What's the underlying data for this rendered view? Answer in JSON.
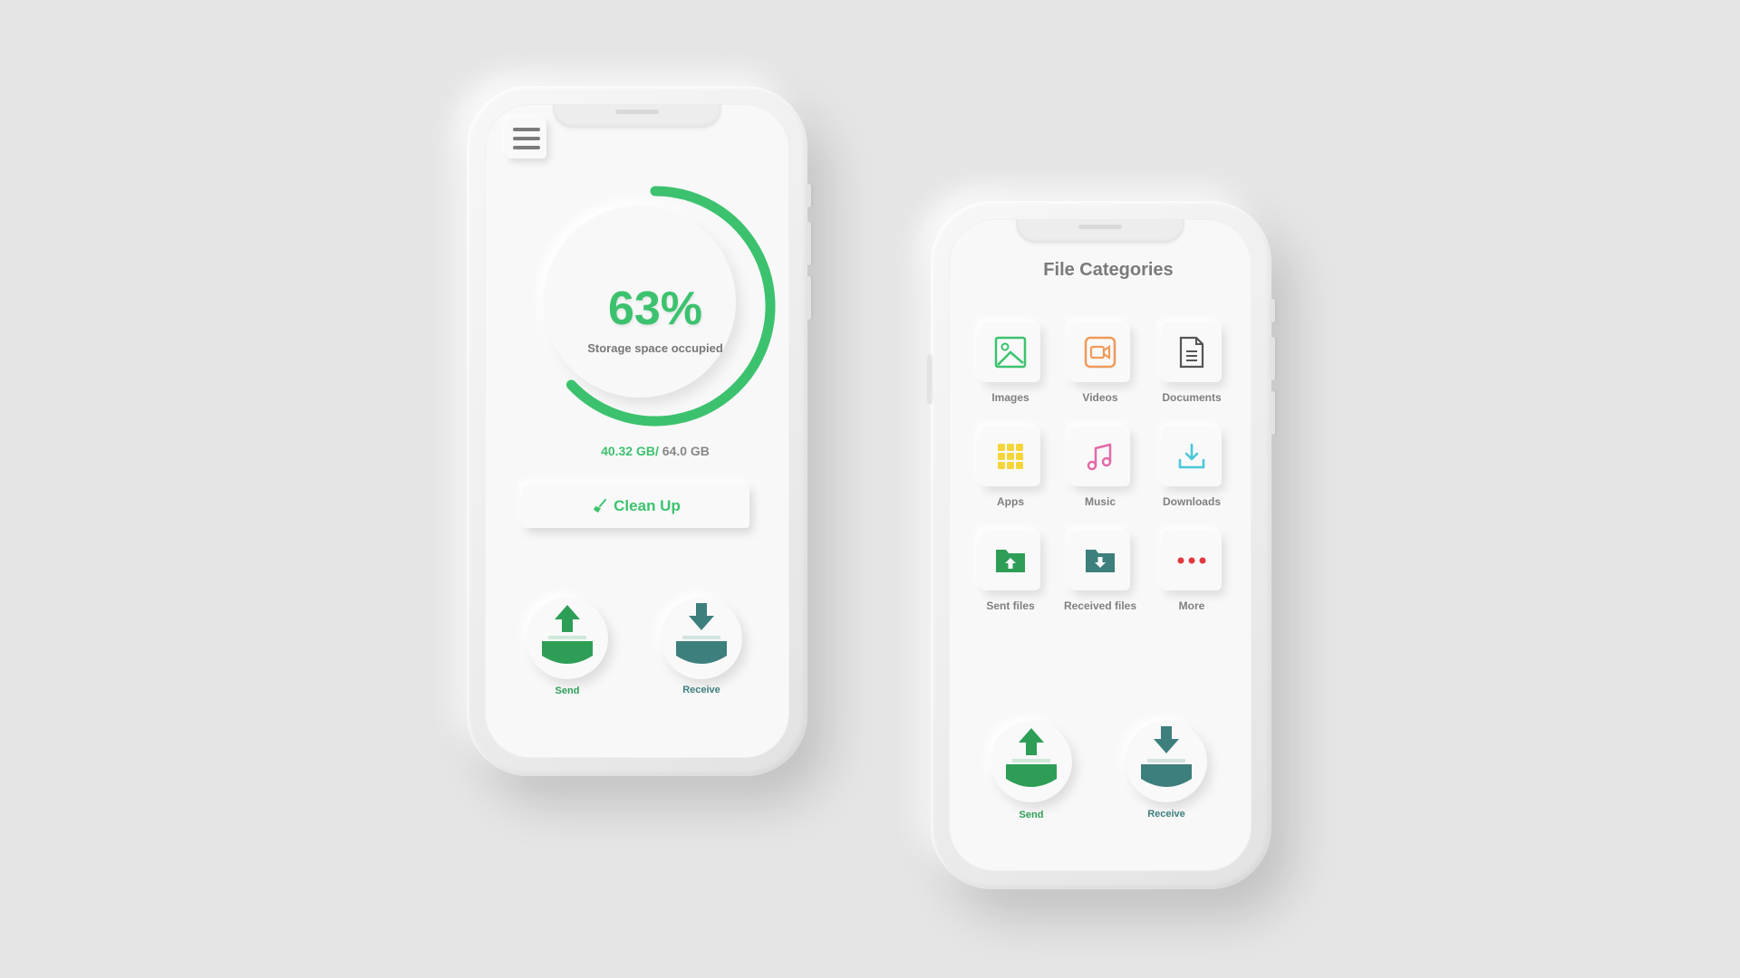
{
  "home": {
    "percent": "63%",
    "percent_label": "Storage space occupied",
    "used": "40.32 GB/",
    "total": " 64.0 GB",
    "clean_up": "Clean Up",
    "storage_fraction": 0.63,
    "send_label": "Send",
    "receive_label": "Receive"
  },
  "categories_screen": {
    "title": "File Categories",
    "items": [
      {
        "label": "Images",
        "icon": "image-icon",
        "color": "#3cc26e"
      },
      {
        "label": "Videos",
        "icon": "video-icon",
        "color": "#f09a5a"
      },
      {
        "label": "Documents",
        "icon": "document-icon",
        "color": "#555555"
      },
      {
        "label": "Apps",
        "icon": "apps-grid-icon",
        "color": "#f5d63a"
      },
      {
        "label": "Music",
        "icon": "music-icon",
        "color": "#e26aa8"
      },
      {
        "label": "Downloads",
        "icon": "download-icon",
        "color": "#4cc7d8"
      },
      {
        "label": "Sent files",
        "icon": "folder-upload-icon",
        "color": "#2e9e57"
      },
      {
        "label": "Received files",
        "icon": "folder-download-icon",
        "color": "#3d7f7d"
      },
      {
        "label": "More",
        "icon": "more-dots-icon",
        "color": "#e0393e"
      }
    ],
    "send_label": "Send",
    "receive_label": "Receive"
  },
  "colors": {
    "accent_green": "#3cc26e",
    "send_green": "#2e9e57",
    "receive_teal": "#3d7f7d"
  }
}
